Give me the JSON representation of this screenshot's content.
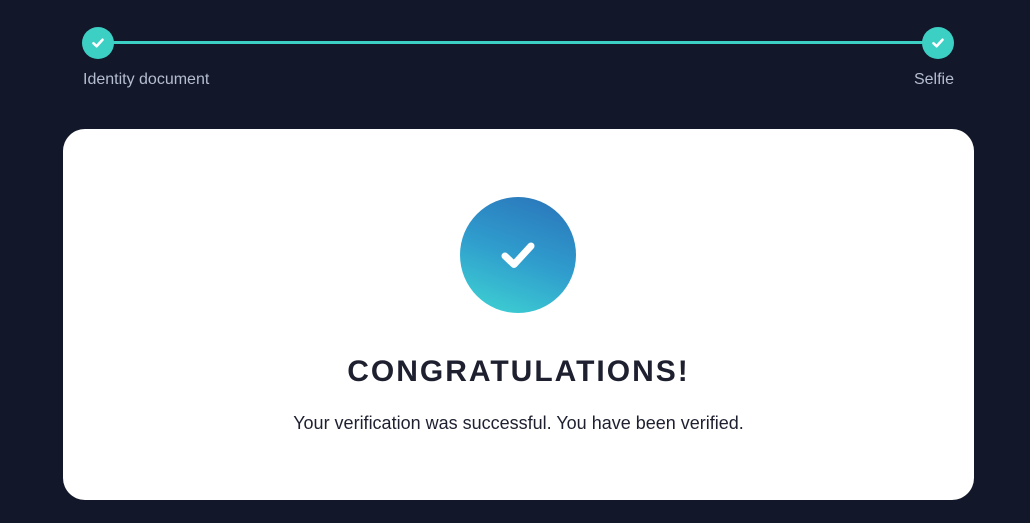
{
  "stepper": {
    "steps": [
      {
        "label": "Identity document",
        "status": "complete",
        "icon": "check-icon"
      },
      {
        "label": "Selfie",
        "status": "complete",
        "icon": "check-icon"
      }
    ],
    "progress": 1.0
  },
  "card": {
    "icon": "check-icon",
    "title": "CONGRATULATIONS!",
    "message": "Your verification was successful. You have been verified."
  },
  "colors": {
    "background": "#13172a",
    "accent": "#3ccfc4",
    "badge_top": "#2a72b8",
    "badge_bottom": "#3fd6d3",
    "card": "#ffffff",
    "text": "#1e2030",
    "label": "#b5bdd0"
  }
}
